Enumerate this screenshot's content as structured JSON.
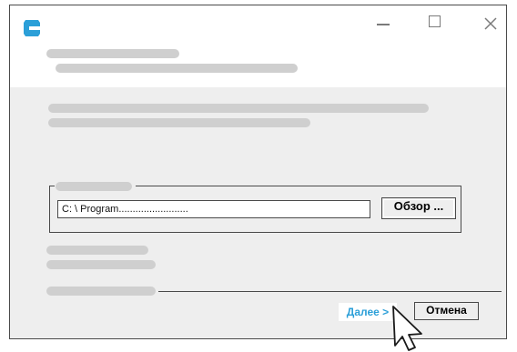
{
  "window": {
    "controls": {
      "minimize": "minimize-icon",
      "maximize": "maximize-icon",
      "close": "close-icon"
    },
    "logo": {
      "icon": "app-logo-icon",
      "color": "#2b9fd8"
    }
  },
  "install_path": {
    "value": "C: \\ Program.........................",
    "browse_label": "Обзор ..."
  },
  "buttons": {
    "next_label": "Далее >",
    "next_color": "#2b9fd8",
    "cancel_label": "Отмена"
  },
  "cursor": {
    "icon": "mouse-pointer-icon"
  },
  "colors": {
    "content_bg": "#eeeeee",
    "placeholder": "#cfcfcf",
    "accent": "#2b9fd8",
    "border": "#4a4a4a"
  }
}
